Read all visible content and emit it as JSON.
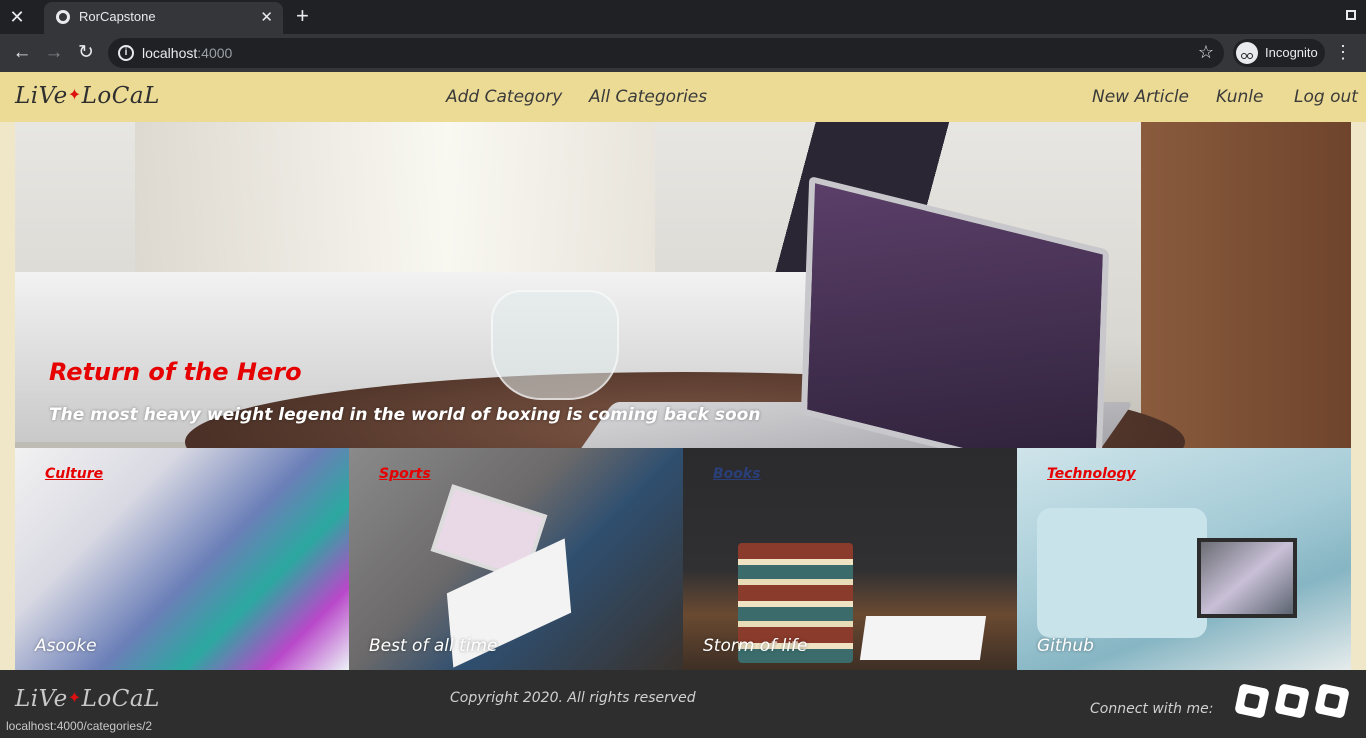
{
  "browser": {
    "tab_title": "RorCapstone",
    "url_host": "localhost",
    "url_port": ":4000",
    "profile_label": "Incognito",
    "icons": [
      "close-icon",
      "globe-icon",
      "plus-icon",
      "back-icon",
      "forward-icon",
      "reload-icon",
      "info-icon",
      "star-icon",
      "incognito-icon",
      "kebab-icon",
      "restore-icon"
    ]
  },
  "navbar": {
    "brand_left": "LiVe",
    "brand_star": "✦",
    "brand_right": "LoCaL",
    "links": [
      "Add Category",
      "All Categories"
    ],
    "right_links": [
      "New Article",
      "Kunle",
      "Log out"
    ]
  },
  "hero": {
    "title": "Return of the Hero",
    "subtitle": "The most heavy weight legend in the world of boxing is coming back soon"
  },
  "cards": [
    {
      "category": "Culture",
      "title": "Asooke"
    },
    {
      "category": "Sports",
      "title": "Best of all time"
    },
    {
      "category": "Books",
      "title": "Storm of life"
    },
    {
      "category": "Technology",
      "title": "Github"
    }
  ],
  "footer": {
    "copyright": "Copyright 2020. All rights reserved",
    "connect": "Connect with me:",
    "social_icons": [
      "social-icon-1",
      "social-icon-2",
      "social-icon-3"
    ]
  },
  "status_url": "localhost:4000/categories/2",
  "colors": {
    "navbar_bg": "#ecdb95",
    "accent_red": "#e60000",
    "footer_bg": "#2e2e2e"
  }
}
